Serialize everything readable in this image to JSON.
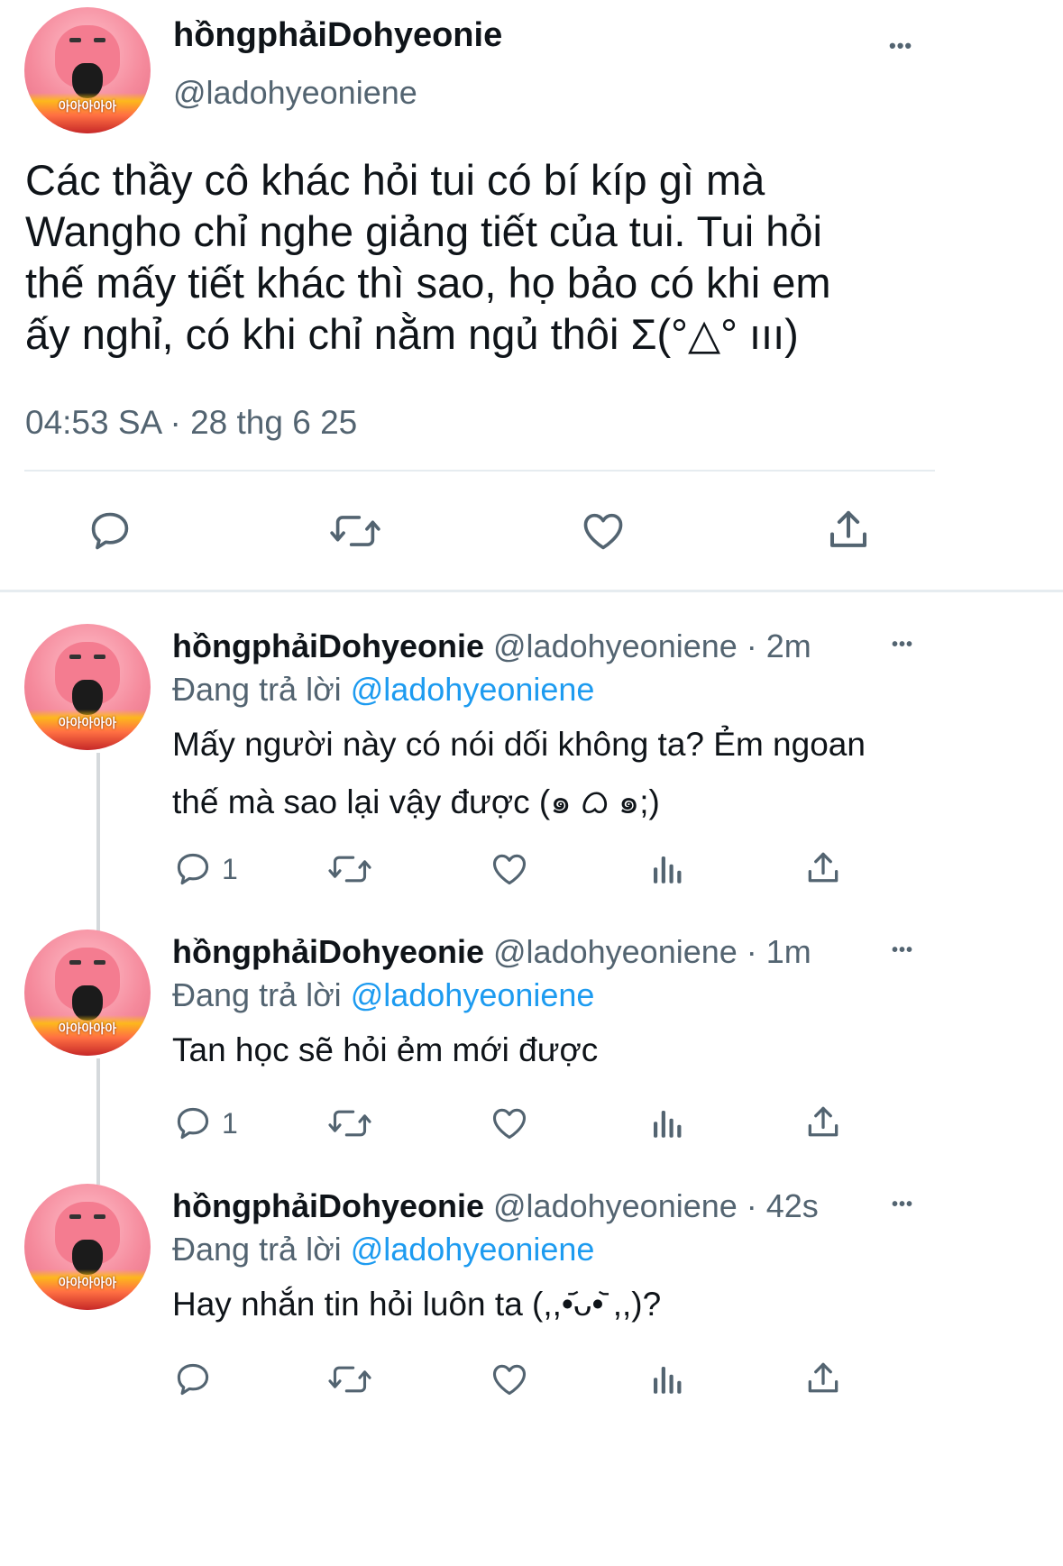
{
  "main_tweet": {
    "display_name": "hồngphảiDohyeonie",
    "handle": "@ladohyeoniene",
    "more_label": "•••",
    "text_lines": [
      "Các thầy cô khác hỏi tui có bí kíp gì mà",
      "Wangho chỉ nghe giảng tiết của tui. Tui hỏi",
      "thế mấy tiết khác thì sao, họ bảo có khi em",
      "ấy nghỉ, có khi chỉ nằm ngủ thôi Σ(°△° ııı)"
    ],
    "timestamp": "04:53 SA · 28 thg 6 25",
    "avatar_text": "아아아아아"
  },
  "replies": [
    {
      "display_name": "hồngphảiDohyeonie",
      "handle_time": "@ladohyeoniene · 2m",
      "more_label": "•••",
      "replying_prefix": "Đang trả lời ",
      "replying_to": "@ladohyeoniene",
      "text_lines": [
        "Mấy người này có nói dối không ta? Ẻm ngoan",
        "thế mà sao lại vậy được (๑ ᜊ ๑;)"
      ],
      "reply_count": "1",
      "avatar_text": "아아아아아"
    },
    {
      "display_name": "hồngphảiDohyeonie",
      "handle_time": "@ladohyeoniene · 1m",
      "more_label": "•••",
      "replying_prefix": "Đang trả lời ",
      "replying_to": "@ladohyeoniene",
      "text_lines": [
        "Tan học sẽ hỏi ẻm mới được"
      ],
      "reply_count": "1",
      "avatar_text": "아아아아아"
    },
    {
      "display_name": "hồngphảiDohyeonie",
      "handle_time": "@ladohyeoniene · 42s",
      "more_label": "•••",
      "replying_prefix": "Đang trả lời ",
      "replying_to": "@ladohyeoniene",
      "text_lines": [
        "Hay nhắn tin hỏi luôn ta (,,•᷄ᴗ•᷅ ,,)?"
      ],
      "reply_count": "",
      "avatar_text": "아아아아아"
    }
  ],
  "colors": {
    "accent": "#1d9bf0",
    "secondary_text": "#536471",
    "divider": "#e6ecf0"
  },
  "icons": [
    "reply-icon",
    "retweet-icon",
    "like-icon",
    "views-icon",
    "share-icon",
    "more-icon"
  ]
}
